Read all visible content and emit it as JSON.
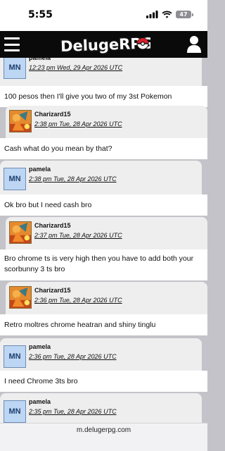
{
  "status_bar": {
    "time": "5:55",
    "battery": "47"
  },
  "header": {
    "logo_text": "DelugeRPG"
  },
  "messages": [
    {
      "user": "pamela",
      "avatar": "MN",
      "time": "12:23 pm Wed, 29 Apr 2026 UTC",
      "text": "100 pesos then I'll give you two of my 3st Pokemon"
    },
    {
      "user": "Charizard15",
      "time": "2:38 pm Tue, 28 Apr 2026 UTC",
      "text": "Cash what do you mean by that?"
    },
    {
      "user": "pamela",
      "avatar": "MN",
      "time": "2:38 pm Tue, 28 Apr 2026 UTC",
      "text": "Ok bro but I need cash bro"
    },
    {
      "user": "Charizard15",
      "time": "2:37 pm Tue, 28 Apr 2026 UTC",
      "text": "Bro chrome ts is very high then you have to add both your scorbunny 3 ts bro"
    },
    {
      "user": "Charizard15",
      "time": "2:36 pm Tue, 28 Apr 2026 UTC",
      "text": "Retro moltres chrome heatran and shiny tinglu"
    },
    {
      "user": "pamela",
      "avatar": "MN",
      "time": "2:36 pm Tue, 28 Apr 2026 UTC",
      "text": "I need Chrome 3ts bro"
    },
    {
      "user": "pamela",
      "avatar": "MN",
      "time": "2:35 pm Tue, 28 Apr 2026 UTC",
      "text": ""
    }
  ],
  "url_bar": {
    "url": "m.delugerpg.com"
  },
  "colors": {
    "header_bg": "#0a0a0a",
    "page_bg": "#c3c3c9",
    "card_head_bg": "#eeeeee",
    "avatar_bg": "#bcd6f3"
  }
}
